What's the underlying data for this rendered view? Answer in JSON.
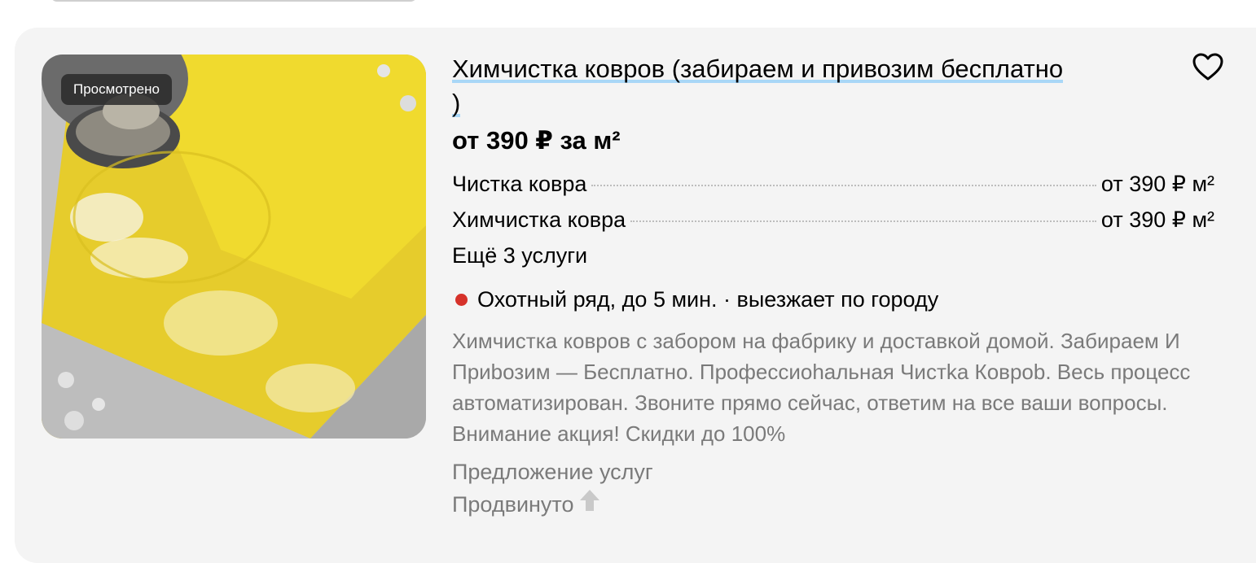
{
  "listing": {
    "title": "Химчистка ковров (забираем и привозим бесплатно )",
    "price": "от 390 ₽ за м²",
    "viewed_badge": "Просмотрено",
    "services": [
      {
        "name": "Чистка ковра",
        "price": "от 390 ₽ м²"
      },
      {
        "name": "Химчистка ковра",
        "price": "от 390 ₽ м²"
      }
    ],
    "more_services": "Ещё 3 услуги",
    "location": "Охотный ряд, до 5 мин. · выезжает по городу",
    "metro_color": "#d6322a",
    "description": "Химчистка ковров с забором на фабрику и доставкой домой. Забираем И Приbозим — Бесплатно. Профессиоhальная Чистkа Коврob. Весь процесс автоматизирован. Звоните прямо сейчас, ответим на все ваши вопросы. Внимание акция! Скидки до 100%",
    "category": "Предложение услуг",
    "promoted": "Продвинуто",
    "icons": {
      "favorite": "heart-icon",
      "promoted": "arrow-up-icon",
      "metro": "metro-dot-icon"
    },
    "colors": {
      "card_background": "#f4f4f4",
      "muted_text": "#7a7a7a",
      "title_underline": "#a9d7f7"
    }
  }
}
